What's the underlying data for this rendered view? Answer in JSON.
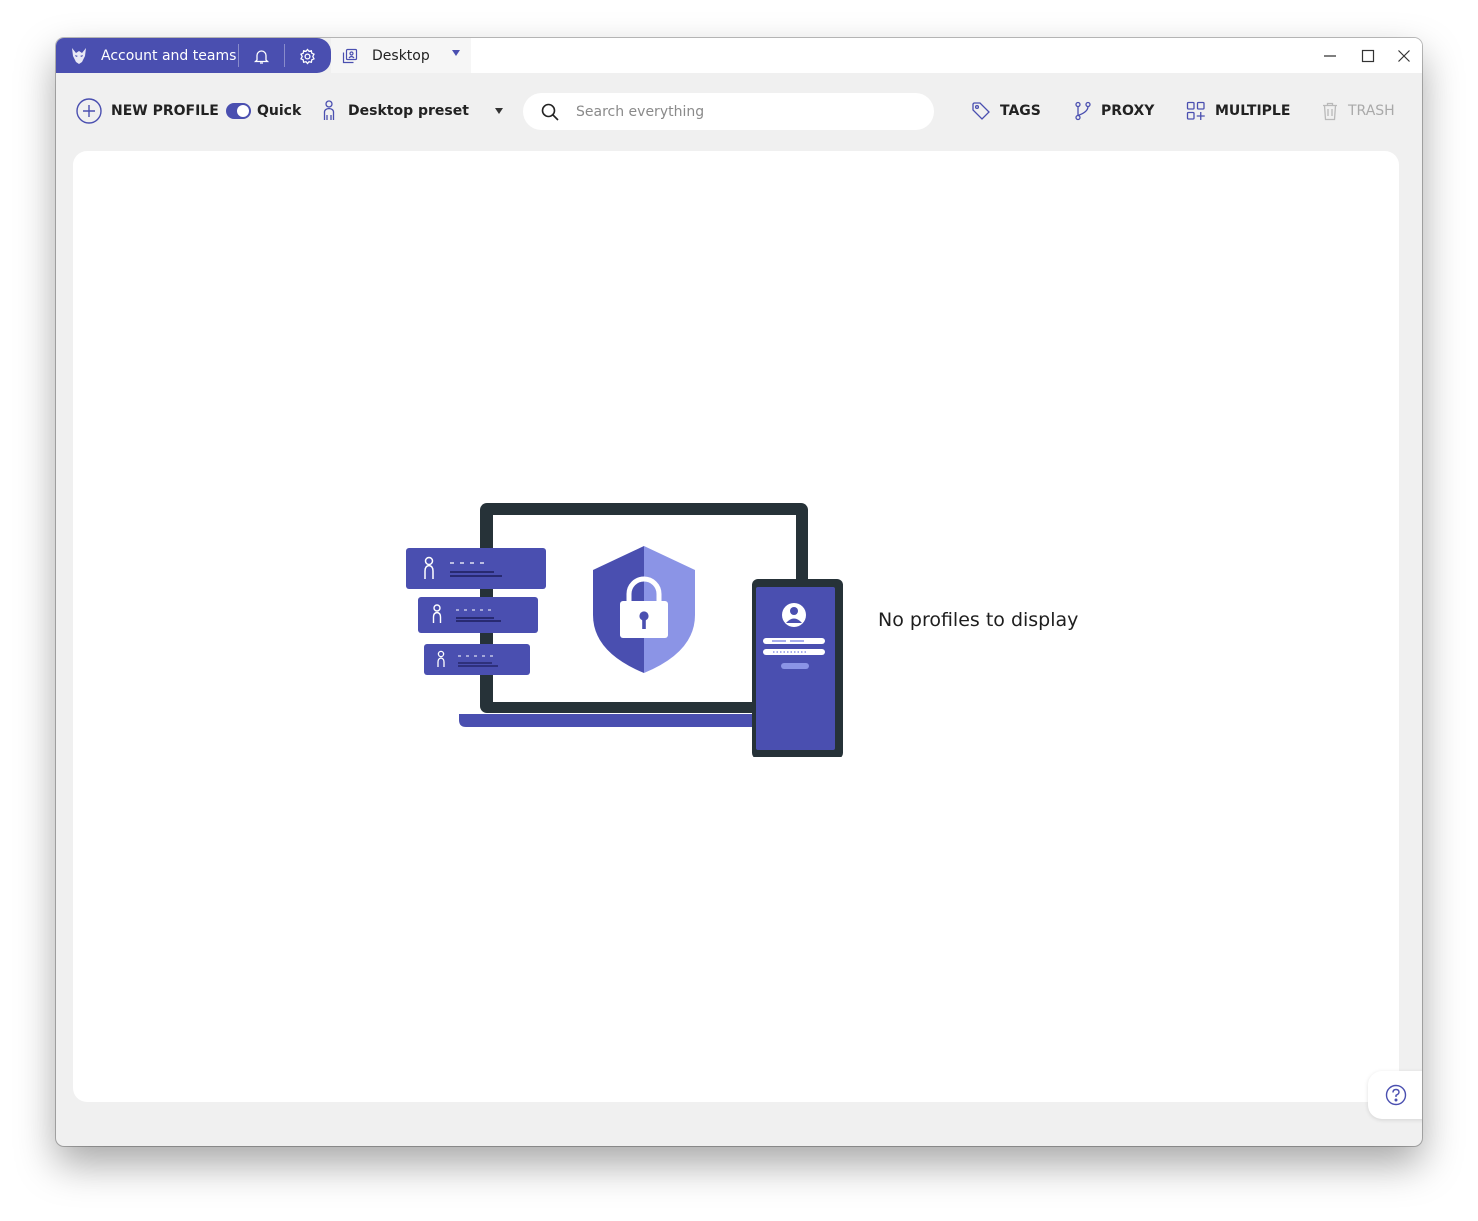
{
  "app": {
    "account_tab_label": "Account and teams",
    "active_tab_label": "Desktop",
    "accent_color": "#4a4fb0"
  },
  "icons": {
    "logo": "wolf-logo-icon",
    "notifications": "bell-icon",
    "settings": "gear-icon",
    "tab": "profiles-icon",
    "help": "help-icon"
  },
  "toolbar": {
    "new_profile_label": "NEW PROFILE",
    "quick_label": "Quick",
    "quick_enabled": true,
    "preset_label": "Desktop preset",
    "search_placeholder": "Search everything",
    "search_value": "",
    "tags_label": "TAGS",
    "proxy_label": "PROXY",
    "multiple_label": "MULTIPLE",
    "trash_label": "TRASH"
  },
  "main": {
    "empty_message": "No profiles to display"
  }
}
